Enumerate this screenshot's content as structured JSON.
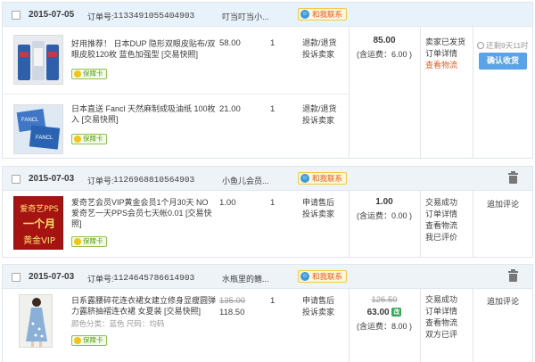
{
  "orders": [
    {
      "date": "2015-07-05",
      "order_label": "订单号:",
      "order_no": "1133491055404903",
      "shop": "叮当叮当小...",
      "contact": "和我联系",
      "items": [
        {
          "title": "好用推荐！ 日本DUP 隐形双眼皮贴布/双眼皮胶120枚 蓝色加强型 [交易快照]",
          "price": "58.00",
          "qty": "1",
          "ops": [
            "退款/退货",
            "投诉卖家"
          ],
          "badge": "保障卡"
        },
        {
          "title": "日本直送 Fancl 天然麻制成吸油纸 100枚入 [交易快照]",
          "price": "21.00",
          "qty": "1",
          "ops": [
            "退款/退货",
            "投诉卖家"
          ],
          "badge": "保障卡"
        }
      ],
      "total": "85.00",
      "shipping": "(含运费：6.00 )",
      "status": [
        "卖家已发货",
        "订单详情",
        "查看物流"
      ],
      "countdown": "还剩9天11时",
      "action_button": "确认收货"
    },
    {
      "date": "2015-07-03",
      "order_label": "订单号:",
      "order_no": "1126968810564903",
      "shop": "小鱼儿会员...",
      "contact": "和我联系",
      "items": [
        {
          "title": "爱奇艺会员VIP黄金会员1个月30天 NO 爱奇艺一天PPS会员七天帐0.01 [交易快照]",
          "price": "1.00",
          "qty": "1",
          "ops": [
            "申请售后",
            "投诉卖家"
          ],
          "badge": "保障卡",
          "thumb_lines": [
            "爱奇艺PPS",
            "一个月",
            "黄金VIP"
          ]
        }
      ],
      "total": "1.00",
      "shipping": "(含运费：0.00 )",
      "status": [
        "交易成功",
        "订单详情",
        "查看物流",
        "我已评价"
      ],
      "action_link": "追加评论"
    },
    {
      "date": "2015-07-03",
      "order_label": "订单号:",
      "order_no": "1124645786614903",
      "shop": "水瓶里的鳍...",
      "contact": "和我联系",
      "items": [
        {
          "title": "日系露腰碎花连衣裙女建立修身显瘦圆弹力露脐抽褶连衣裙 女夏装 [交易快照]",
          "meta": "颜色分类：蓝色  尺码：均码",
          "old_price": "135.00",
          "price": "118.50",
          "qty": "1",
          "ops": [
            "申请售后",
            "投诉卖家"
          ],
          "badge": "保障卡"
        }
      ],
      "old_total": "126.50",
      "total": "63.00",
      "total_tag": "改",
      "shipping": "(含运费：8.00 )",
      "status": [
        "交易成功",
        "订单详情",
        "查看物流",
        "双方已评"
      ],
      "action_link": "追加评论"
    }
  ],
  "colors": {
    "accent_orange": "#e05b1e",
    "button_blue": "#5aa3e6",
    "header_bg": "#eef3f8"
  }
}
